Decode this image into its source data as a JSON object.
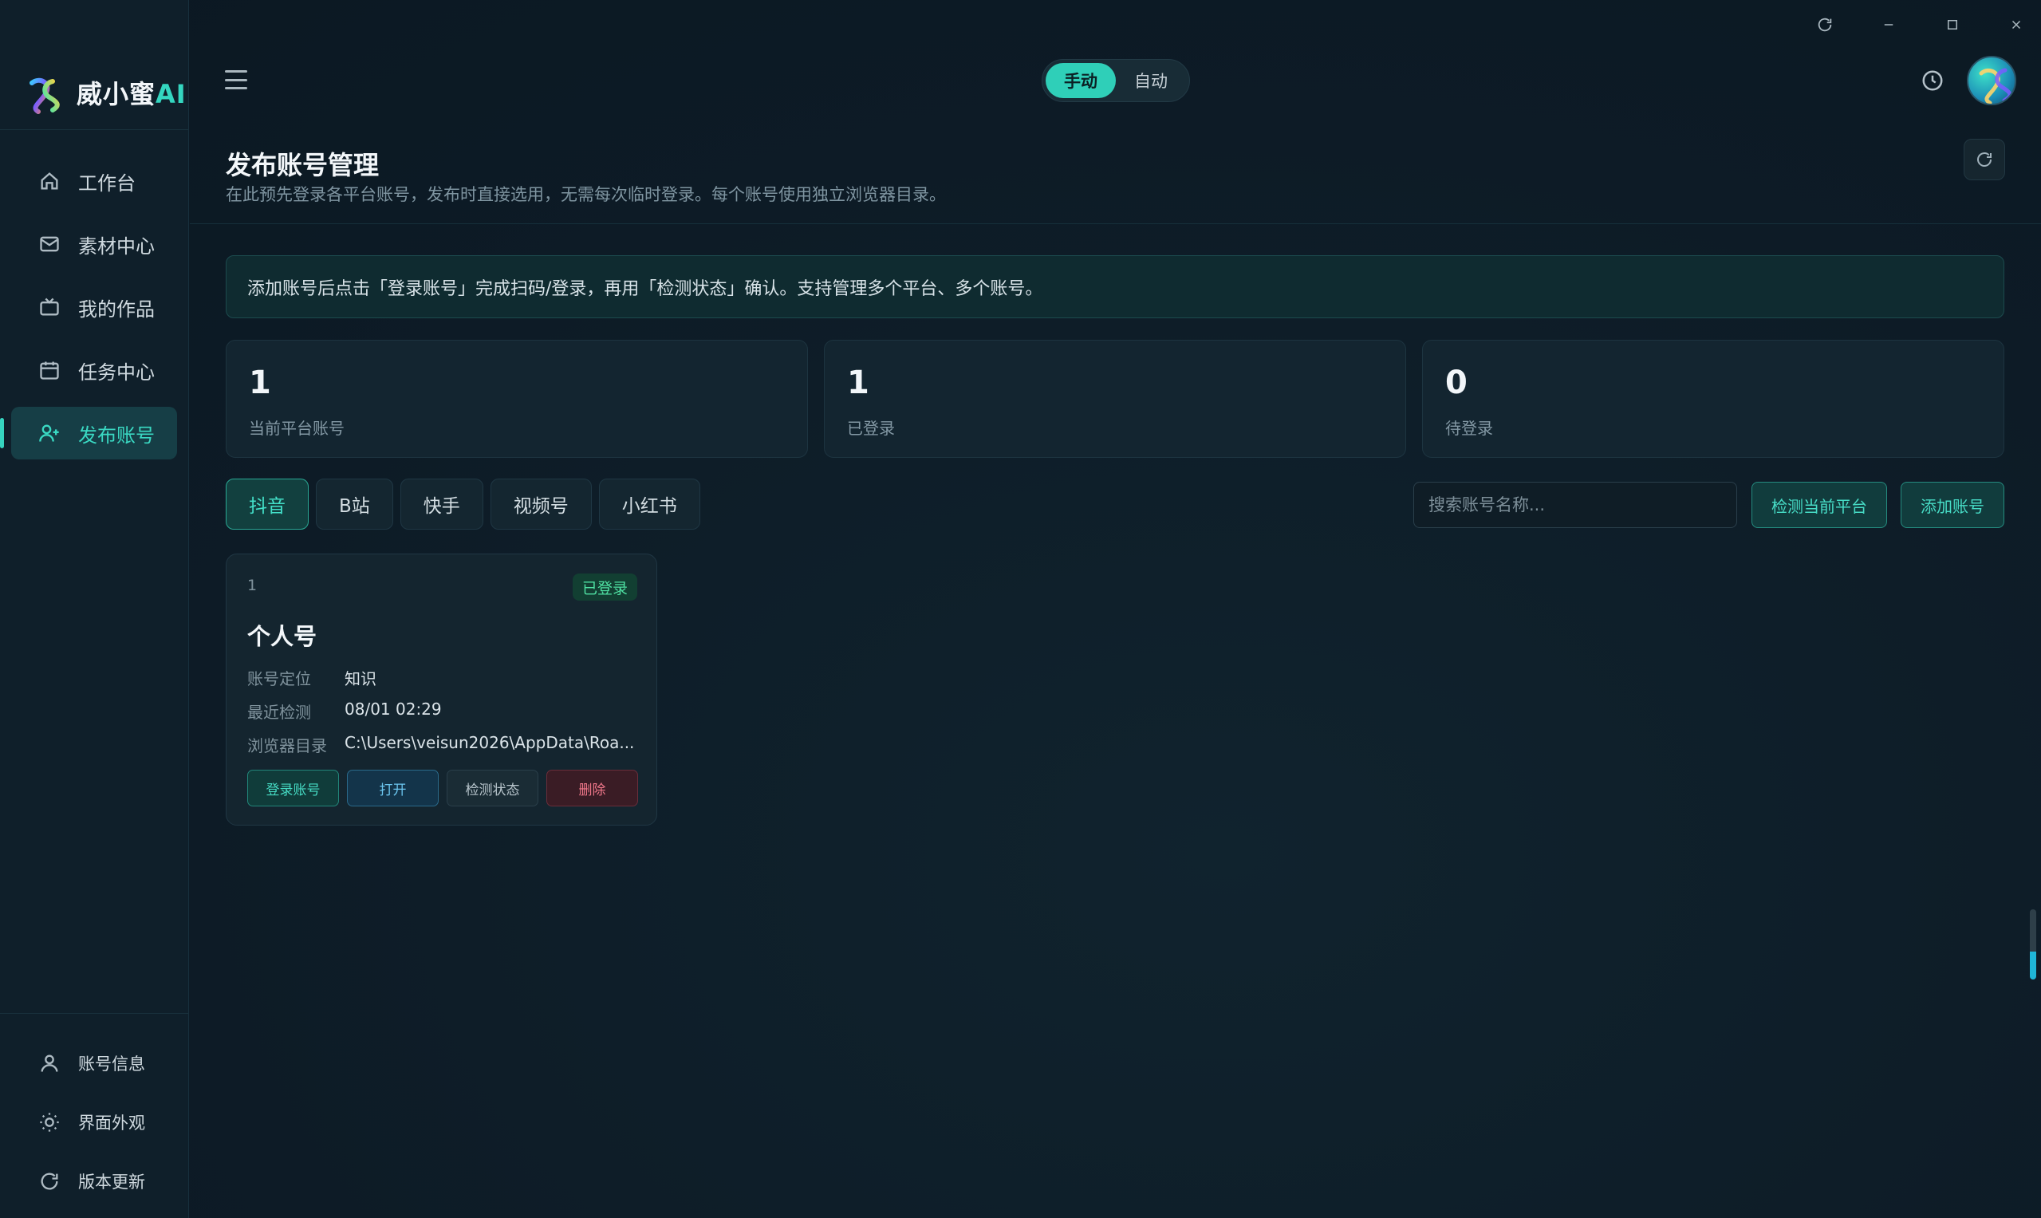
{
  "brand": {
    "name": "威小蜜",
    "suffix": "AI"
  },
  "sidebar": {
    "items": [
      {
        "label": "工作台",
        "icon": "home-icon"
      },
      {
        "label": "素材中心",
        "icon": "mail-icon"
      },
      {
        "label": "我的作品",
        "icon": "tv-icon"
      },
      {
        "label": "任务中心",
        "icon": "calendar-icon"
      },
      {
        "label": "发布账号",
        "icon": "user-plus-icon",
        "active": true
      }
    ],
    "bottom": [
      {
        "label": "账号信息",
        "icon": "user-icon"
      },
      {
        "label": "界面外观",
        "icon": "sun-icon"
      },
      {
        "label": "版本更新",
        "icon": "refresh-icon"
      }
    ]
  },
  "topbar": {
    "mode_manual": "手动",
    "mode_auto": "自动",
    "active_mode": "手动"
  },
  "page": {
    "title": "发布账号管理",
    "subtitle": "在此预先登录各平台账号，发布时直接选用，无需每次临时登录。每个账号使用独立浏览器目录。",
    "notice": "添加账号后点击「登录账号」完成扫码/登录，再用「检测状态」确认。支持管理多个平台、多个账号。"
  },
  "stats": [
    {
      "value": "1",
      "label": "当前平台账号"
    },
    {
      "value": "1",
      "label": "已登录"
    },
    {
      "value": "0",
      "label": "待登录"
    }
  ],
  "tabs": [
    "抖音",
    "B站",
    "快手",
    "视频号",
    "小红书"
  ],
  "active_tab": "抖音",
  "search": {
    "placeholder": "搜索账号名称...",
    "value": ""
  },
  "buttons": {
    "check_platform": "检测当前平台",
    "add_account": "添加账号"
  },
  "accounts": [
    {
      "index": "1",
      "status": "已登录",
      "name": "个人号",
      "fields": [
        {
          "k": "账号定位",
          "v": "知识"
        },
        {
          "k": "最近检测",
          "v": "08/01 02:29"
        },
        {
          "k": "浏览器目录",
          "v": "C:\\Users\\veisun2026\\AppData\\Roa..."
        }
      ],
      "actions": {
        "login": "登录账号",
        "open": "打开",
        "check": "检测状态",
        "delete": "删除"
      }
    }
  ],
  "colors": {
    "accent": "#2fcfb8",
    "background": "#0e1d28",
    "danger": "#f0778a"
  }
}
